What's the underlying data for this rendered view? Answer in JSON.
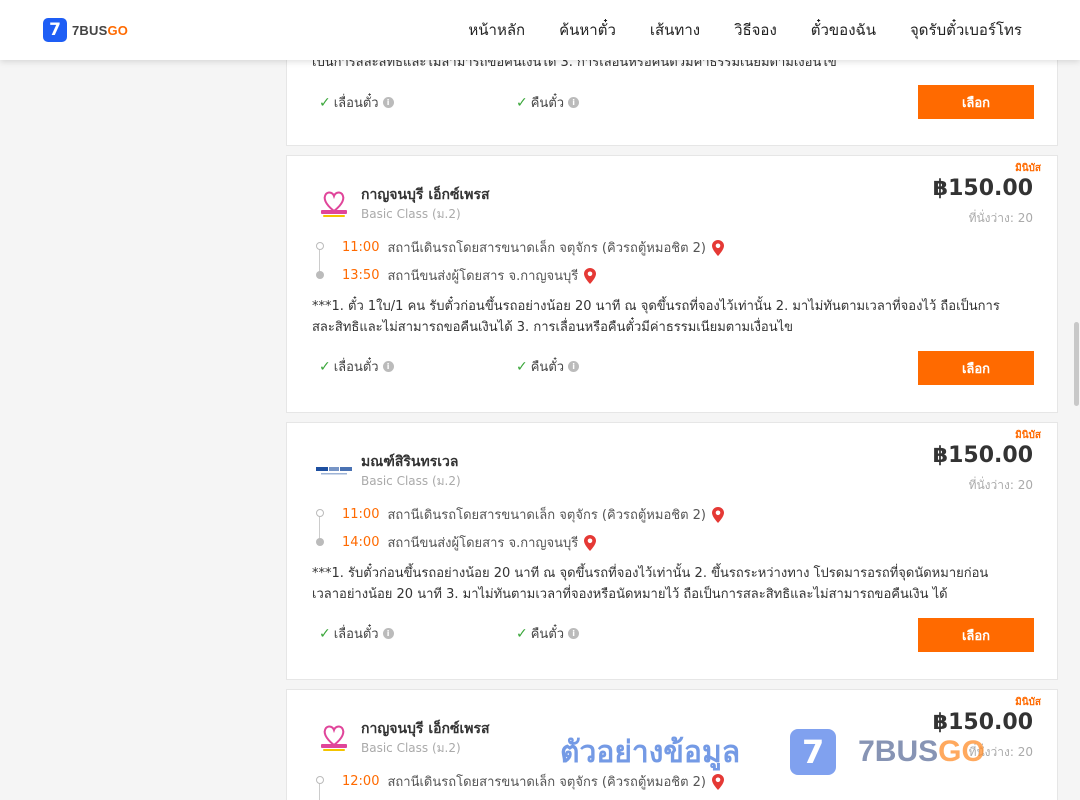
{
  "header": {
    "logo_mark": "7",
    "logo_text_a": "7BUS",
    "logo_text_b": "GO",
    "nav": [
      "หน้าหลัก",
      "ค้นหาตั๋ว",
      "เส้นทาง",
      "วิธีจอง",
      "ตั๋วของฉัน",
      "จุดรับตั๋วเบอร์โทร"
    ]
  },
  "colors": {
    "accent": "#ff6a00",
    "brand_blue": "#1e5ef5",
    "check": "#3aa63a"
  },
  "top_card": {
    "note_clip": "เป็นการสละสิทธิและไม่สามารถขอคืนเงินได้ 3. การเลื่อนหรือคืนตั๋วมีค่าธรรมเนียมตามเงื่อนไข",
    "reschedule": "เลื่อนตั๋ว",
    "refund": "คืนตั๋ว",
    "select": "เลือก"
  },
  "trips": [
    {
      "badge": "มินิบัส",
      "operator": "กาญจนบุรี เอ็กซ์เพรส",
      "class": "Basic Class (ม.2)",
      "price": "฿150.00",
      "seats": "ที่นั่งว่าง: 20",
      "dep_time": "11:00",
      "dep_station": "สถานีเดินรถโดยสารขนาดเล็ก จตุจักร (คิวรถตู้หมอชิต 2)",
      "arr_time": "13:50",
      "arr_station": "สถานีขนส่งผู้โดยสาร จ.กาญจนบุรี",
      "note": "***1. ตั๋ว 1ใบ/1 คน รับตั๋วก่อนขึ้นรถอย่างน้อย 20 นาที ณ จุดขึ้นรถที่จองไว้เท่านั้น 2. มาไม่ทันตามเวลาที่จองไว้ ถือเป็นการสละสิทธิและไม่สามารถขอคืนเงินได้ 3. การเลื่อนหรือคืนตั๋วมีค่าธรรมเนียมตามเงื่อนไข",
      "reschedule": "เลื่อนตั๋ว",
      "refund": "คืนตั๋ว",
      "select": "เลือก"
    },
    {
      "badge": "มินิบัส",
      "operator": "มณฑ์สิรินทรเวล",
      "class": "Basic Class (ม.2)",
      "price": "฿150.00",
      "seats": "ที่นั่งว่าง: 20",
      "dep_time": "11:00",
      "dep_station": "สถานีเดินรถโดยสารขนาดเล็ก จตุจักร (คิวรถตู้หมอชิต 2)",
      "arr_time": "14:00",
      "arr_station": "สถานีขนส่งผู้โดยสาร จ.กาญจนบุรี",
      "note": "***1. รับตั๋วก่อนขึ้นรถอย่างน้อย 20 นาที ณ จุดขึ้นรถที่จองไว้เท่านั้น 2. ขึ้นรถระหว่างทาง โปรดมารอรถที่จุดนัดหมายก่อนเวลาอย่างน้อย 20 นาที 3. มาไม่ทันตามเวลาที่จองหรือนัดหมายไว้ ถือเป็นการสละสิทธิและไม่สามารถขอคืนเงิน ได้",
      "reschedule": "เลื่อนตั๋ว",
      "refund": "คืนตั๋ว",
      "select": "เลือก"
    },
    {
      "badge": "มินิบัส",
      "operator": "กาญจนบุรี เอ็กซ์เพรส",
      "class": "Basic Class (ม.2)",
      "price": "฿150.00",
      "seats": "ที่นั่งว่าง: 20",
      "dep_time": "12:00",
      "dep_station": "สถานีเดินรถโดยสารขนาดเล็ก จตุจักร (คิวรถตู้หมอชิต 2)"
    }
  ],
  "watermark": {
    "text": "ตัวอย่างข้อมูล",
    "mark": "7",
    "brand_a": "7BUS",
    "brand_b": "GO"
  }
}
